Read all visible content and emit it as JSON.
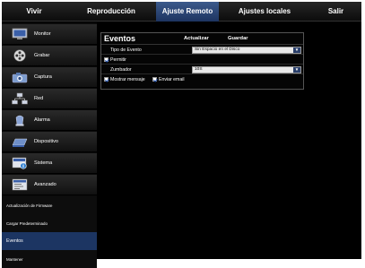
{
  "topnav": {
    "tabs": [
      {
        "label": "Vivir"
      },
      {
        "label": "Reproducción"
      },
      {
        "label": "Ajuste Remoto",
        "active": true
      },
      {
        "label": "Ajustes locales"
      },
      {
        "label": "Salir"
      }
    ]
  },
  "sidebar": {
    "items": [
      {
        "label": "Monitor",
        "icon": "monitor-icon"
      },
      {
        "label": "Grabar",
        "icon": "film-reel-icon"
      },
      {
        "label": "Captura",
        "icon": "camera-icon"
      },
      {
        "label": "Red",
        "icon": "network-icon"
      },
      {
        "label": "Alarma",
        "icon": "alarm-icon"
      },
      {
        "label": "Dispositivo",
        "icon": "disk-icon"
      },
      {
        "label": "Sistema",
        "icon": "system-icon"
      },
      {
        "label": "Avanzado",
        "icon": "advanced-icon"
      }
    ],
    "subitems": [
      {
        "label": "Actualización de Firmware"
      },
      {
        "label": "Cargar Predeterminado"
      },
      {
        "label": "Eventos",
        "active": true
      },
      {
        "label": "Mantener"
      }
    ]
  },
  "panel": {
    "title": "Eventos",
    "refresh_label": "Actualizar",
    "save_label": "Guardar",
    "event_type": {
      "label": "Tipo de Evento",
      "value": "Sin Espacio en el Disco"
    },
    "enable": {
      "label": "Permitir",
      "checked": true
    },
    "buzzer": {
      "label": "Zumbador",
      "value": "10S"
    },
    "show_message": {
      "label": "Mostrar mensaje",
      "checked": true
    },
    "send_email": {
      "label": "Enviar email",
      "checked": true
    }
  },
  "colors": {
    "active_tab": "#1d3460",
    "active_subitem": "#1c3562",
    "select_arrow": "#2a3f6a"
  }
}
